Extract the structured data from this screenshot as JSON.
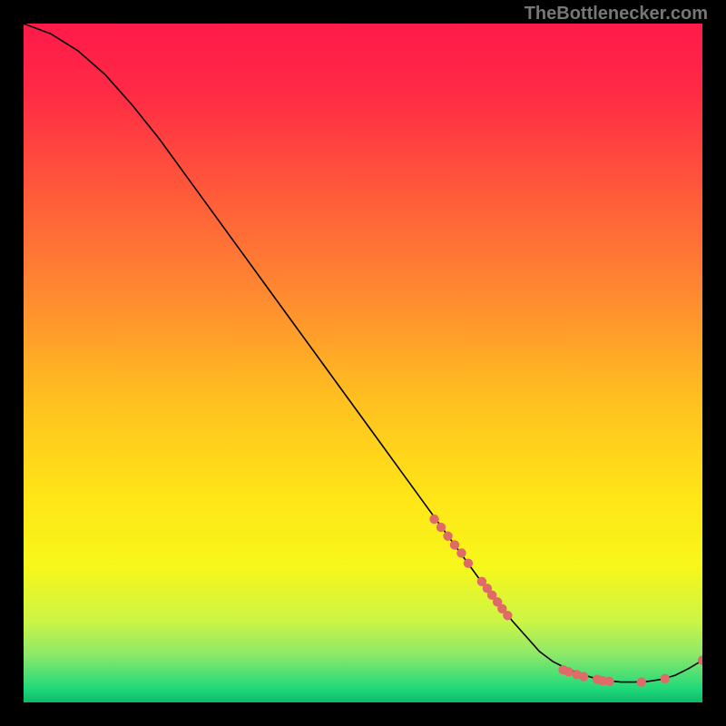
{
  "watermark": "TheBottlenecker.com",
  "chart_data": {
    "type": "line",
    "title": "",
    "xlabel": "",
    "ylabel": "",
    "xlim": [
      0,
      100
    ],
    "ylim": [
      0,
      100
    ],
    "grid": false,
    "legend": false,
    "background_gradient": {
      "stops": [
        {
          "offset": 0.0,
          "color": "#ff1a4a"
        },
        {
          "offset": 0.1,
          "color": "#ff2a45"
        },
        {
          "offset": 0.25,
          "color": "#ff5a3a"
        },
        {
          "offset": 0.4,
          "color": "#ff8a30"
        },
        {
          "offset": 0.55,
          "color": "#ffbf20"
        },
        {
          "offset": 0.7,
          "color": "#ffe617"
        },
        {
          "offset": 0.8,
          "color": "#f7f71a"
        },
        {
          "offset": 0.88,
          "color": "#ccf545"
        },
        {
          "offset": 0.93,
          "color": "#8ce86a"
        },
        {
          "offset": 0.98,
          "color": "#1fd97a"
        },
        {
          "offset": 1.0,
          "color": "#0fb86a"
        }
      ]
    },
    "series": [
      {
        "name": "curve",
        "stroke": "#000000",
        "x": [
          0,
          4,
          8,
          12,
          16,
          20,
          24,
          28,
          32,
          36,
          40,
          44,
          48,
          52,
          56,
          60,
          64,
          68,
          72,
          76,
          78,
          80,
          82,
          84,
          86,
          88,
          90,
          92,
          94,
          96,
          98,
          100
        ],
        "y": [
          100,
          98.5,
          96,
          92.5,
          88,
          83,
          77.5,
          72,
          66.5,
          61,
          55.5,
          50,
          44.5,
          39,
          33.5,
          28,
          22.5,
          17,
          12,
          7.5,
          6,
          5,
          4.2,
          3.6,
          3.2,
          3.0,
          3.0,
          3.1,
          3.4,
          4.0,
          5.0,
          6.2
        ]
      }
    ],
    "scatter_points": {
      "color": "#e06a68",
      "radius": 5.2,
      "points": [
        {
          "x": 60.5,
          "y": 27
        },
        {
          "x": 61.5,
          "y": 25.8
        },
        {
          "x": 62.5,
          "y": 24.5
        },
        {
          "x": 63.5,
          "y": 23.2
        },
        {
          "x": 64.5,
          "y": 22
        },
        {
          "x": 65.5,
          "y": 20.5
        },
        {
          "x": 67.5,
          "y": 17.8
        },
        {
          "x": 68.3,
          "y": 16.8
        },
        {
          "x": 69.0,
          "y": 15.8
        },
        {
          "x": 69.8,
          "y": 14.8
        },
        {
          "x": 70.5,
          "y": 13.8
        },
        {
          "x": 71.3,
          "y": 12.8
        },
        {
          "x": 79.5,
          "y": 4.8
        },
        {
          "x": 80.3,
          "y": 4.5
        },
        {
          "x": 81.5,
          "y": 4.1
        },
        {
          "x": 82.5,
          "y": 3.8
        },
        {
          "x": 84.5,
          "y": 3.4
        },
        {
          "x": 85.3,
          "y": 3.2
        },
        {
          "x": 86.3,
          "y": 3.1
        },
        {
          "x": 91.0,
          "y": 3.0
        },
        {
          "x": 94.5,
          "y": 3.5
        },
        {
          "x": 100,
          "y": 6.2
        }
      ]
    }
  }
}
